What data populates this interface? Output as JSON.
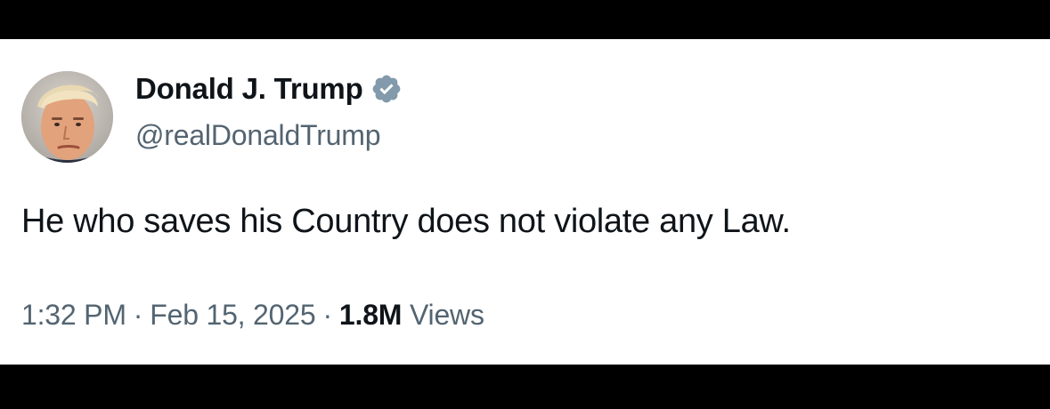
{
  "tweet": {
    "author": {
      "name": "Donald J. Trump",
      "handle": "@realDonaldTrump",
      "verified_icon": "verified-badge-icon",
      "avatar_icon": "avatar-portrait"
    },
    "text": "He who saves his Country does not violate any Law.",
    "time": "1:32 PM",
    "separator": "·",
    "date": "Feb 15, 2025",
    "views_count": "1.8M",
    "views_label": "Views"
  },
  "colors": {
    "text_primary": "#0f1419",
    "text_secondary": "#536471",
    "verified_badge": "#829aab",
    "card_bg": "#ffffff",
    "frame_bg": "#000000"
  }
}
